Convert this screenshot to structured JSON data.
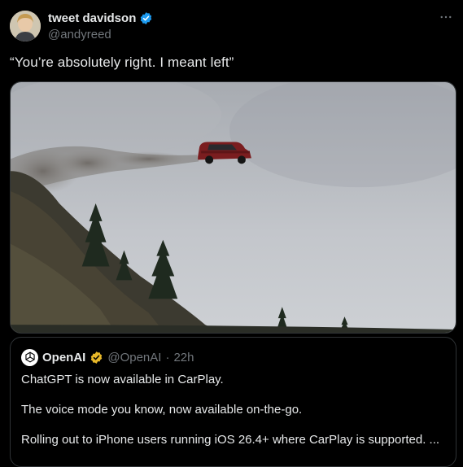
{
  "author": {
    "name": "tweet davidson",
    "handle": "@andyreed",
    "verified_color": "#1d9bf0"
  },
  "tweet": {
    "text": "“You’re absolutely right. I meant left”",
    "media_icon": "video-thumbnail"
  },
  "quoted_tweet": {
    "name": "OpenAI",
    "handle": "@OpenAI",
    "separator": "·",
    "time": "22h",
    "verified_color": "#e8b829",
    "lines": [
      "ChatGPT is now available in CarPlay.",
      "The voice mode you know, now available on-the-go.",
      "Rolling out to iPhone users running iOS 26.4+ where CarPlay is supported.  ..."
    ]
  },
  "icons": {
    "more": "more-horizontal-icon",
    "verified": "verified-badge-icon",
    "gold_verified": "gold-verified-badge-icon",
    "openai_logo": "openai-logo-icon"
  }
}
